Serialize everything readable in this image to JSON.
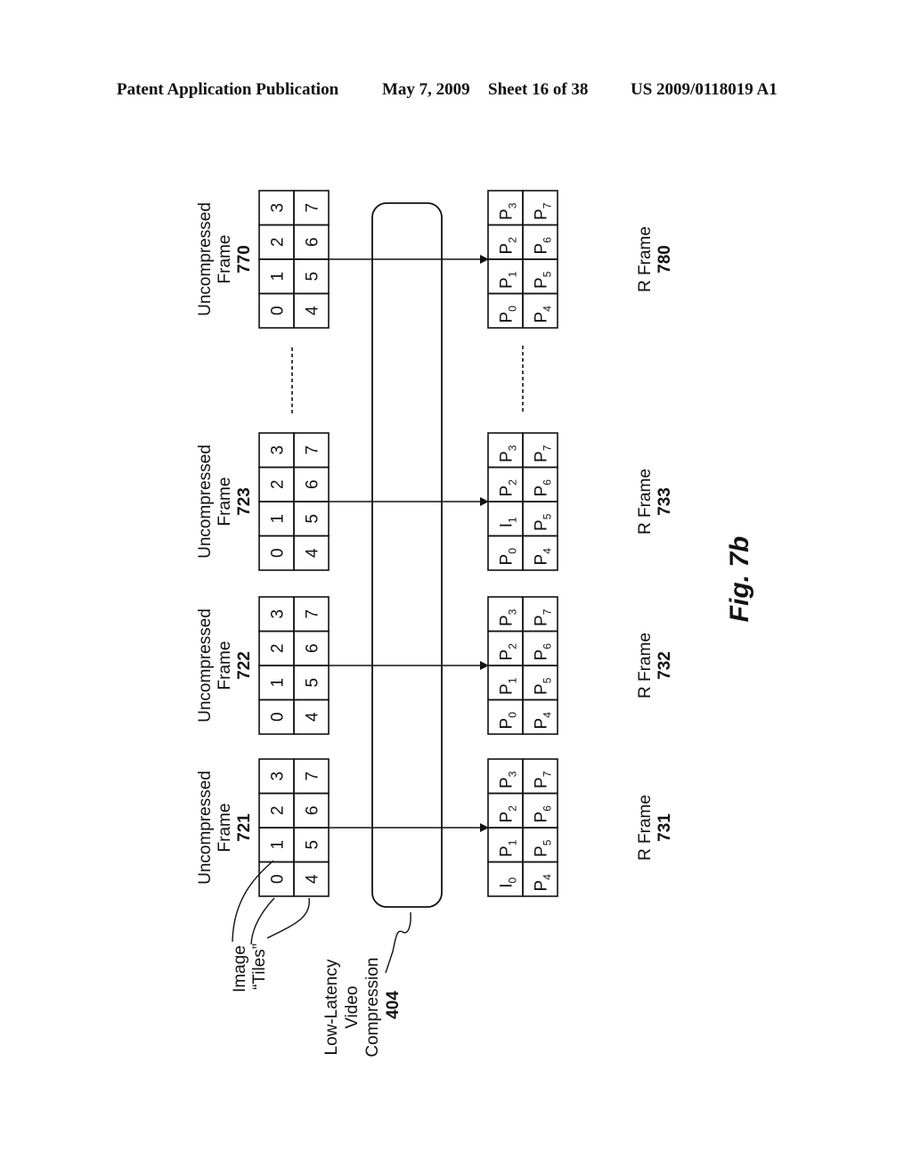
{
  "header": {
    "publication": "Patent Application Publication",
    "date": "May 7, 2009",
    "sheet": "Sheet 16 of 38",
    "number": "US 2009/0118019 A1"
  },
  "figure": {
    "label": "Fig. 7b",
    "orientation": "rotated 90 degrees counter-clockwise",
    "annotations": {
      "tiles_label_line1": "Image",
      "tiles_label_line2": "“Tiles”",
      "compression_line1": "Low-Latency",
      "compression_line2": "Video",
      "compression_line3": "Compression",
      "compression_ref": "404"
    },
    "uncompressed_frames": [
      {
        "title": "Uncompressed",
        "subtitle": "Frame",
        "ref": "721",
        "tiles": [
          "0",
          "1",
          "2",
          "3",
          "4",
          "5",
          "6",
          "7"
        ]
      },
      {
        "title": "Uncompressed",
        "subtitle": "Frame",
        "ref": "722",
        "tiles": [
          "0",
          "1",
          "2",
          "3",
          "4",
          "5",
          "6",
          "7"
        ]
      },
      {
        "title": "Uncompressed",
        "subtitle": "Frame",
        "ref": "723",
        "tiles": [
          "0",
          "1",
          "2",
          "3",
          "4",
          "5",
          "6",
          "7"
        ]
      },
      {
        "title": "Uncompressed",
        "subtitle": "Frame",
        "ref": "770",
        "tiles": [
          "0",
          "1",
          "2",
          "3",
          "4",
          "5",
          "6",
          "7"
        ]
      }
    ],
    "r_frames": [
      {
        "title": "R Frame",
        "ref": "731",
        "tiles": [
          [
            "I",
            "0"
          ],
          [
            "P",
            "1"
          ],
          [
            "P",
            "2"
          ],
          [
            "P",
            "3"
          ],
          [
            "P",
            "4"
          ],
          [
            "P",
            "5"
          ],
          [
            "P",
            "6"
          ],
          [
            "P",
            "7"
          ]
        ]
      },
      {
        "title": "R Frame",
        "ref": "732",
        "tiles": [
          [
            "P",
            "0"
          ],
          [
            "P",
            "1"
          ],
          [
            "P",
            "2"
          ],
          [
            "P",
            "3"
          ],
          [
            "P",
            "4"
          ],
          [
            "P",
            "5"
          ],
          [
            "P",
            "6"
          ],
          [
            "P",
            "7"
          ]
        ]
      },
      {
        "title": "R Frame",
        "ref": "733",
        "tiles": [
          [
            "P",
            "0"
          ],
          [
            "I",
            "1"
          ],
          [
            "P",
            "2"
          ],
          [
            "P",
            "3"
          ],
          [
            "P",
            "4"
          ],
          [
            "P",
            "5"
          ],
          [
            "P",
            "6"
          ],
          [
            "P",
            "7"
          ]
        ]
      },
      {
        "title": "R Frame",
        "ref": "780",
        "tiles": [
          [
            "P",
            "0"
          ],
          [
            "P",
            "1"
          ],
          [
            "P",
            "2"
          ],
          [
            "P",
            "3"
          ],
          [
            "P",
            "4"
          ],
          [
            "P",
            "5"
          ],
          [
            "P",
            "6"
          ],
          [
            "P",
            "7"
          ]
        ]
      }
    ]
  }
}
